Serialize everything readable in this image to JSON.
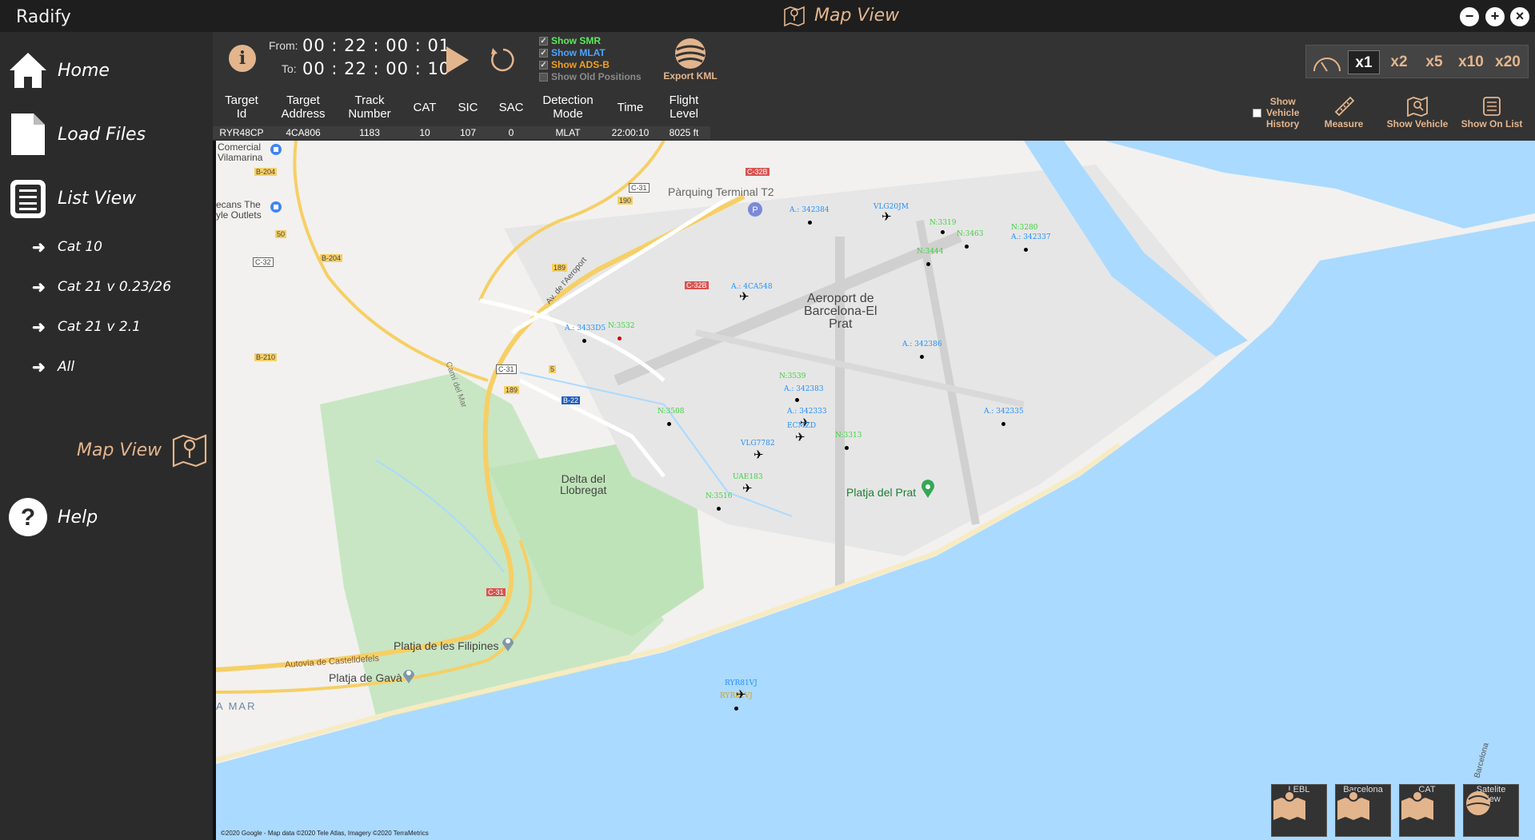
{
  "app": {
    "title": "Radify",
    "window_title": "Map View"
  },
  "window_buttons": {
    "minimize": "−",
    "maximize": "+",
    "close": "×"
  },
  "sidebar": {
    "home": "Home",
    "load_files": "Load Files",
    "list_view": "List View",
    "sub_items": [
      "Cat 10",
      "Cat 21 v 0.23/26",
      "Cat 21 v 2.1",
      "All"
    ],
    "map_view": "Map View",
    "help": "Help"
  },
  "toolbar": {
    "info": "i",
    "from_label": "From:",
    "to_label": "To:",
    "from_time": "00 : 22 : 00 : 01",
    "to_time": "00 : 22 : 00 : 10",
    "checkboxes": [
      {
        "label": "Show SMR",
        "color": "#5ee85e"
      },
      {
        "label": "Show MLAT",
        "color": "#4da3ff"
      },
      {
        "label": "Show ADS-B",
        "color": "#f2a01c"
      },
      {
        "label": "Show Old Positions",
        "color": "#8a8a8a"
      }
    ],
    "export_kml": "Export KML"
  },
  "speed": {
    "options": [
      "x1",
      "x2",
      "x5",
      "x10",
      "x20"
    ],
    "selected": "x1"
  },
  "vehicle_table": {
    "headers": [
      "Target\nId",
      "Target\nAddress",
      "Track\nNumber",
      "CAT",
      "SIC",
      "SAC",
      "Detection\nMode",
      "Time",
      "Flight\nLevel"
    ],
    "row": [
      "RYR48CP",
      "4CA806",
      "1183",
      "10",
      "107",
      "0",
      "MLAT",
      "22:00:10",
      "8025 ft"
    ]
  },
  "tools": {
    "show_history": "Show\nVehicle\nHistory",
    "measure": "Measure",
    "show_vehicle": "Show Vehicle",
    "show_on_list": "Show On List"
  },
  "map": {
    "labels": {
      "airport": "Aeroport de\nBarcelona-El\nPrat",
      "parking": "Pàrquing Terminal T2",
      "delta": "Delta del\nLlobregat",
      "platja_prat": "Platja del Prat",
      "platja_filipines": "Platja de les Filipines",
      "platja_gava": "Platja de Gavà",
      "autovia": "Autovia de Castelldefels",
      "comercial": "Comercial\nVilamarina",
      "outlets": "ecans The\nyle Outlets",
      "mar": "A MAR",
      "cami": "Camí del Mar",
      "av_aeroport": "Av. de l'Aeroport",
      "barcelona": "Barcelona"
    },
    "roads": [
      "B-204",
      "C-31",
      "190",
      "C-32B",
      "50",
      "C-32",
      "B-204",
      "189",
      "C-32B",
      "B-210",
      "C-31",
      "5",
      "189",
      "B-22",
      "C-31"
    ],
    "targets": [
      {
        "text": "A.: 342384",
        "color": "#1e90ff"
      },
      {
        "text": "VLG20JM",
        "color": "#1e90ff"
      },
      {
        "text": "N:3319",
        "color": "#3fd13f"
      },
      {
        "text": "N:3463",
        "color": "#3fd13f"
      },
      {
        "text": "N:3280",
        "color": "#3fd13f"
      },
      {
        "text": "A.: 342337",
        "color": "#1e90ff"
      },
      {
        "text": "N:3444",
        "color": "#3fd13f"
      },
      {
        "text": "A.: 4CA548",
        "color": "#1e90ff"
      },
      {
        "text": "A.: 3433D5",
        "color": "#1e90ff"
      },
      {
        "text": "N:3532",
        "color": "#3fd13f"
      },
      {
        "text": "A.: 342386",
        "color": "#1e90ff"
      },
      {
        "text": "N:3539",
        "color": "#3fd13f"
      },
      {
        "text": "A.: 342383",
        "color": "#1e90ff"
      },
      {
        "text": "N:3508",
        "color": "#3fd13f"
      },
      {
        "text": "A.: 342333",
        "color": "#1e90ff"
      },
      {
        "text": "ECMZD",
        "color": "#1e90ff"
      },
      {
        "text": "N:3313",
        "color": "#3fd13f"
      },
      {
        "text": "A.: 342335",
        "color": "#1e90ff"
      },
      {
        "text": "VLG7782",
        "color": "#1e90ff"
      },
      {
        "text": "UAE183",
        "color": "#3fd13f"
      },
      {
        "text": "N:3516",
        "color": "#3fd13f"
      },
      {
        "text": "RYR81VJ",
        "color": "#1e90ff"
      },
      {
        "text": "RYR81VJ",
        "color": "#d4a017"
      }
    ],
    "copyright": "©2020 Google - Map data ©2020 Tele Atlas, Imagery ©2020 TerraMetrics",
    "buttons": [
      "LEBL",
      "Barcelona",
      "CAT",
      "Satelite\nView"
    ]
  },
  "colors": {
    "accent": "#e3b58d",
    "sidebar": "#2b2b2b",
    "toolbar": "#333333",
    "water": "#aadaff"
  }
}
